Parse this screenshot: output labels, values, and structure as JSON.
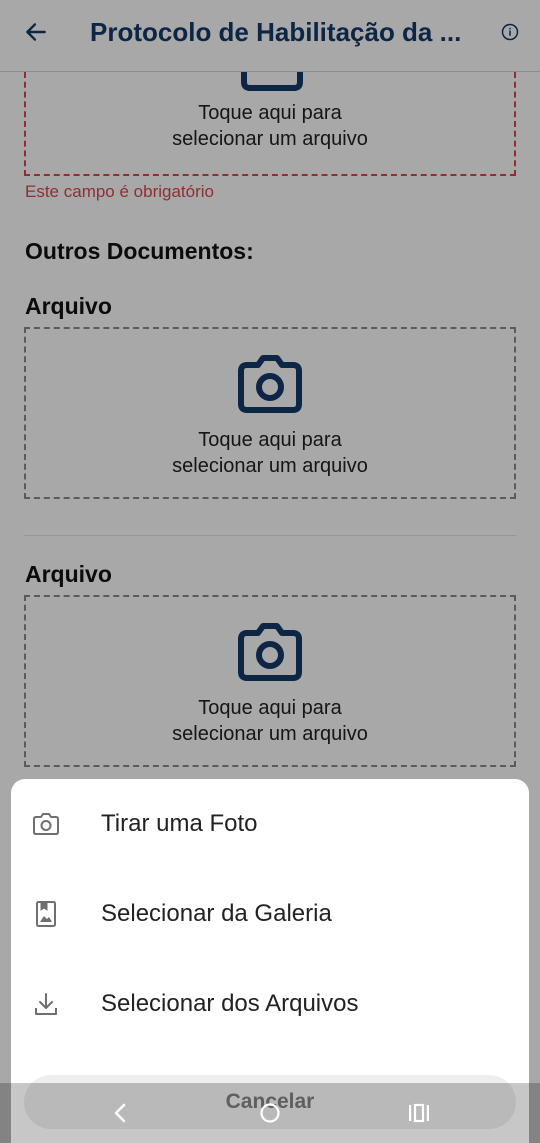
{
  "header": {
    "title": "Protocolo de Habilitação da ...",
    "back_icon": "arrow-left-icon",
    "info_icon": "info-icon"
  },
  "form": {
    "upload_line1": "Toque aqui para",
    "upload_line2": "selecionar um arquivo",
    "required_error": "Este campo é obrigatório",
    "section_title": "Outros Documentos:",
    "fields": [
      {
        "label": "Arquivo",
        "line1": "Toque aqui para",
        "line2": "selecionar um arquivo"
      },
      {
        "label": "Arquivo",
        "line1": "Toque aqui para",
        "line2": "selecionar um arquivo"
      }
    ]
  },
  "sheet": {
    "items": [
      {
        "label": "Tirar uma Foto",
        "icon": "camera-icon"
      },
      {
        "label": "Selecionar da Galeria",
        "icon": "gallery-icon"
      },
      {
        "label": "Selecionar dos Arquivos",
        "icon": "download-icon"
      }
    ],
    "cancel_label": "Cancelar"
  },
  "colors": {
    "primary": "#153b69",
    "error": "#d84a4a"
  }
}
